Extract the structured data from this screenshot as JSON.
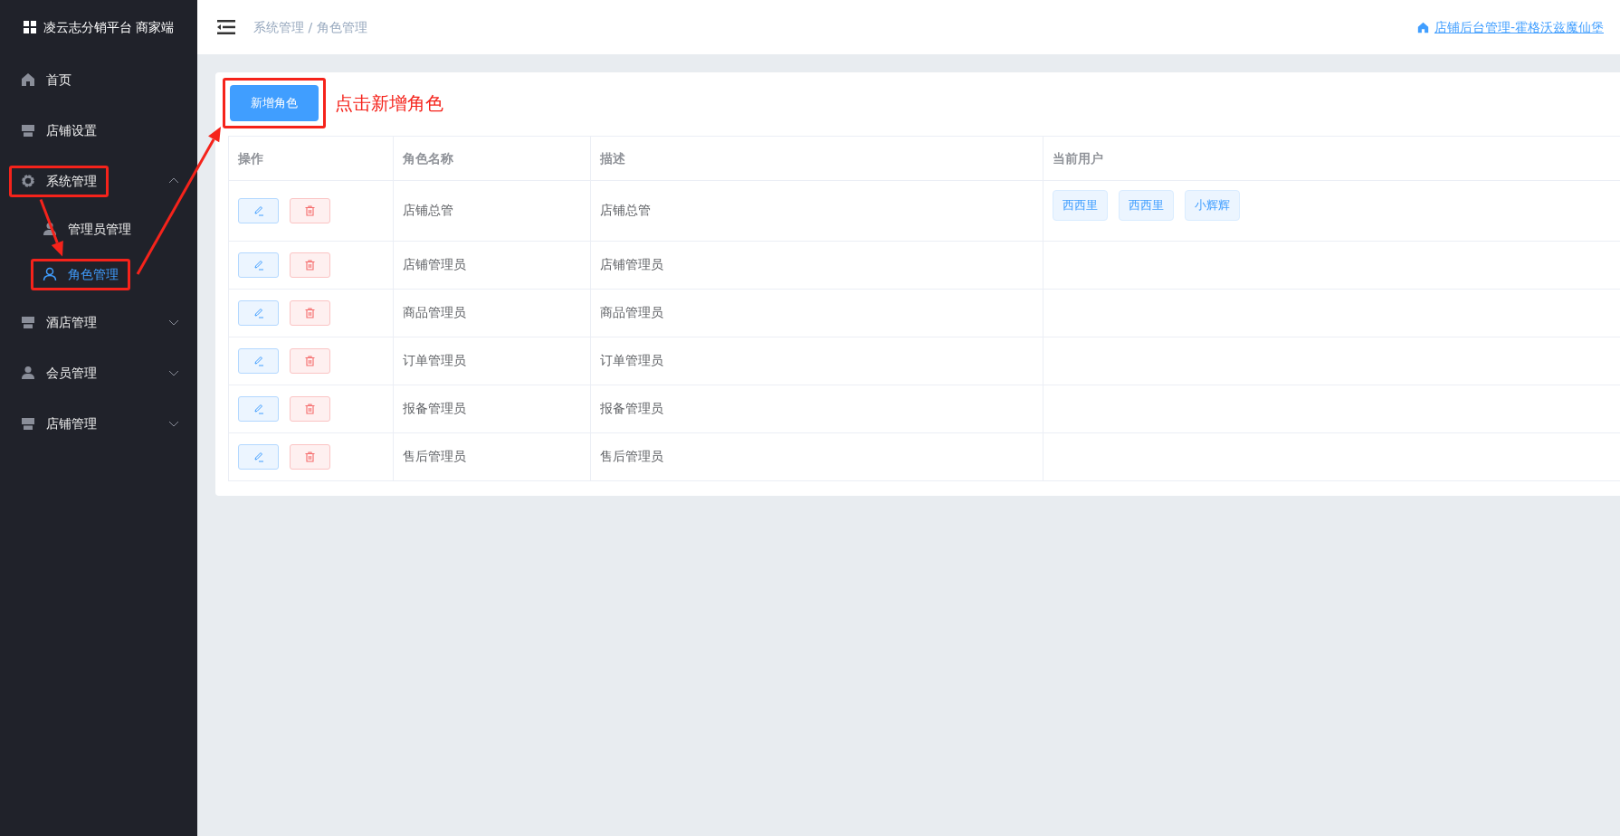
{
  "sidebar": {
    "brand": "凌云志分销平台 商家端",
    "items": [
      {
        "label": "首页",
        "kind": "home",
        "selected": false,
        "annotated": false
      },
      {
        "label": "店铺设置",
        "kind": "store",
        "selected": false,
        "annotated": false
      },
      {
        "label": "系统管理",
        "kind": "gear",
        "selected": false,
        "annotated": true,
        "expanded": true,
        "children": [
          {
            "label": "管理员管理",
            "kind": "person",
            "selected": false,
            "annotated": false
          },
          {
            "label": "角色管理",
            "kind": "person",
            "selected": true,
            "annotated": true
          }
        ]
      },
      {
        "label": "酒店管理",
        "kind": "store",
        "selected": false,
        "annotated": false,
        "expanded": false
      },
      {
        "label": "会员管理",
        "kind": "person",
        "selected": false,
        "annotated": false,
        "expanded": false
      },
      {
        "label": "店铺管理",
        "kind": "store",
        "selected": false,
        "annotated": false,
        "expanded": false
      }
    ]
  },
  "header": {
    "breadcrumb": "系统管理 / 角色管理",
    "shop_link": "店铺后台管理-霍格沃兹魔仙堡"
  },
  "toolbar": {
    "add_button": "新增角色",
    "annotated": true,
    "annotation_text": "点击新增角色"
  },
  "table": {
    "columns": [
      "操作",
      "角色名称",
      "描述",
      "当前用户"
    ],
    "rows": [
      {
        "name": "店铺总管",
        "description": "店铺总管",
        "users": [
          "西西里",
          "西西里",
          "小辉辉"
        ]
      },
      {
        "name": "店铺管理员",
        "description": "店铺管理员"
      },
      {
        "name": "商品管理员",
        "description": "商品管理员"
      },
      {
        "name": "订单管理员",
        "description": "订单管理员"
      },
      {
        "name": "报备管理员",
        "description": "报备管理员"
      },
      {
        "name": "售后管理员",
        "description": "售后管理员"
      }
    ]
  }
}
